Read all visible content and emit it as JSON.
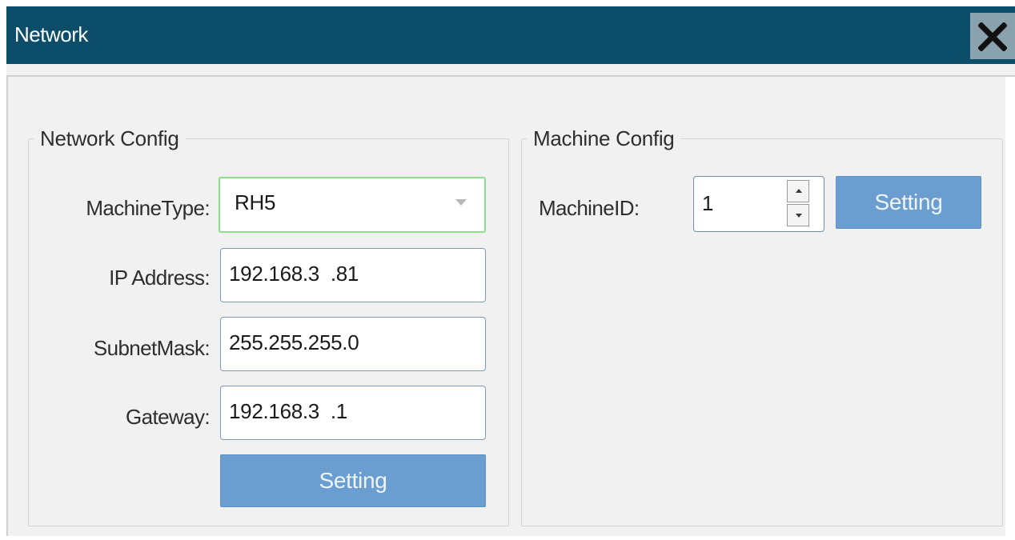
{
  "window": {
    "title": "Network",
    "close_icon": "close-icon"
  },
  "network_config": {
    "title": "Network Config",
    "machine_type": {
      "label": "MachineType:",
      "value": "RH5",
      "icon": "chevron-down-icon"
    },
    "ip_address": {
      "label": "IP Address:",
      "value": "192.168.3  .81"
    },
    "subnet_mask": {
      "label": "SubnetMask:",
      "value": "255.255.255.0"
    },
    "gateway": {
      "label": "Gateway:",
      "value": "192.168.3  .1"
    },
    "setting_label": "Setting"
  },
  "machine_config": {
    "title": "Machine Config",
    "machine_id": {
      "label": "MachineID:",
      "value": "1"
    },
    "setting_label": "Setting"
  },
  "colors": {
    "titlebar": "#0c4d6a",
    "button": "#6a9ed1",
    "combo_border": "#8cde8c",
    "field_border": "#7a9ab8"
  }
}
